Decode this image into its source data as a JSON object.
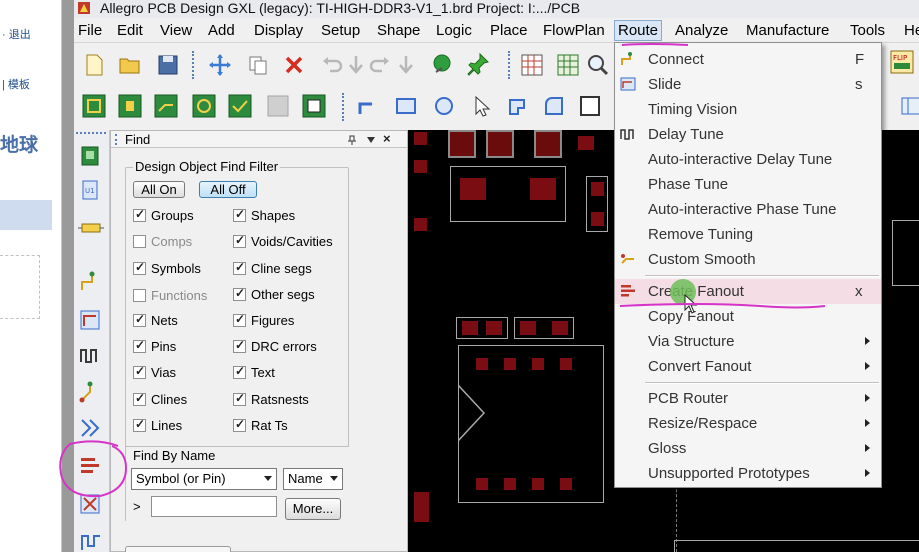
{
  "browser": {
    "logout_label": "· 退出",
    "template_label": "| 模板",
    "globe_text": "地球"
  },
  "window": {
    "title": "Allegro PCB Design GXL (legacy): TI-HIGH-DDR3-V1_1.brd  Project: I:.../PCB"
  },
  "menubar": [
    "File",
    "Edit",
    "View",
    "Add",
    "Display",
    "Setup",
    "Shape",
    "Logic",
    "Place",
    "FlowPlan",
    "Route",
    "Analyze",
    "Manufacture",
    "Tools",
    "He"
  ],
  "find_panel": {
    "title": "Find",
    "pin_icon": "pin-icon",
    "close_glyph": "×",
    "filter_group_label": "Design Object Find Filter",
    "all_on_label": "All On",
    "all_off_label": "All Off",
    "left_checks": [
      {
        "label": "Groups",
        "checked": true,
        "enabled": true
      },
      {
        "label": "Comps",
        "checked": false,
        "enabled": false
      },
      {
        "label": "Symbols",
        "checked": true,
        "enabled": true
      },
      {
        "label": "Functions",
        "checked": false,
        "enabled": false
      },
      {
        "label": "Nets",
        "checked": true,
        "enabled": true
      },
      {
        "label": "Pins",
        "checked": true,
        "enabled": true
      },
      {
        "label": "Vias",
        "checked": true,
        "enabled": true
      },
      {
        "label": "Clines",
        "checked": true,
        "enabled": true
      },
      {
        "label": "Lines",
        "checked": true,
        "enabled": true
      }
    ],
    "right_checks": [
      {
        "label": "Shapes",
        "checked": true
      },
      {
        "label": "Voids/Cavities",
        "checked": true
      },
      {
        "label": "Cline segs",
        "checked": true
      },
      {
        "label": "Other segs",
        "checked": true
      },
      {
        "label": "Figures",
        "checked": true
      },
      {
        "label": "DRC errors",
        "checked": true
      },
      {
        "label": "Text",
        "checked": true
      },
      {
        "label": "Ratsnests",
        "checked": true
      },
      {
        "label": "Rat Ts",
        "checked": true
      }
    ],
    "find_by_name_label": "Find By Name",
    "type_select": "Symbol (or Pin)",
    "mode_select": "Name",
    "arrow_glyph": ">",
    "name_value": "",
    "more_button": "More..."
  },
  "route_menu": {
    "items": [
      {
        "label": "Connect",
        "shortcut": "F",
        "icon": "connect-icon",
        "submenu": false
      },
      {
        "label": "Slide",
        "shortcut": "s",
        "icon": "slide-icon",
        "submenu": false
      },
      {
        "label": "Timing Vision",
        "shortcut": "",
        "icon": "",
        "submenu": false
      },
      {
        "label": "Delay Tune",
        "shortcut": "",
        "icon": "delay-tune-icon",
        "submenu": false
      },
      {
        "label": "Auto-interactive Delay Tune",
        "shortcut": "",
        "icon": "",
        "submenu": false
      },
      {
        "label": "Phase Tune",
        "shortcut": "",
        "icon": "",
        "submenu": false
      },
      {
        "label": "Auto-interactive Phase Tune",
        "shortcut": "",
        "icon": "",
        "submenu": false
      },
      {
        "label": "Remove Tuning",
        "shortcut": "",
        "icon": "",
        "submenu": false
      },
      {
        "label": "Custom Smooth",
        "shortcut": "",
        "icon": "custom-smooth-icon",
        "submenu": false
      },
      {
        "label": "Create Fanout",
        "shortcut": "x",
        "icon": "create-fanout-icon",
        "submenu": false,
        "highlighted": true
      },
      {
        "label": "Copy Fanout",
        "shortcut": "",
        "icon": "",
        "submenu": false
      },
      {
        "label": "Via Structure",
        "shortcut": "",
        "icon": "",
        "submenu": true
      },
      {
        "label": "Convert Fanout",
        "shortcut": "",
        "icon": "",
        "submenu": true
      },
      {
        "label": "PCB Router",
        "shortcut": "",
        "icon": "",
        "submenu": true
      },
      {
        "label": "Resize/Respace",
        "shortcut": "",
        "icon": "",
        "submenu": true
      },
      {
        "label": "Gloss",
        "shortcut": "",
        "icon": "",
        "submenu": true
      },
      {
        "label": "Unsupported Prototypes",
        "shortcut": "",
        "icon": "",
        "submenu": true
      }
    ]
  },
  "colors": {
    "canvas_bg": "#000000",
    "pad_red": "#7a0d12",
    "annotation_pen": "#d633c8",
    "highlight_row": "#f4dde4"
  }
}
